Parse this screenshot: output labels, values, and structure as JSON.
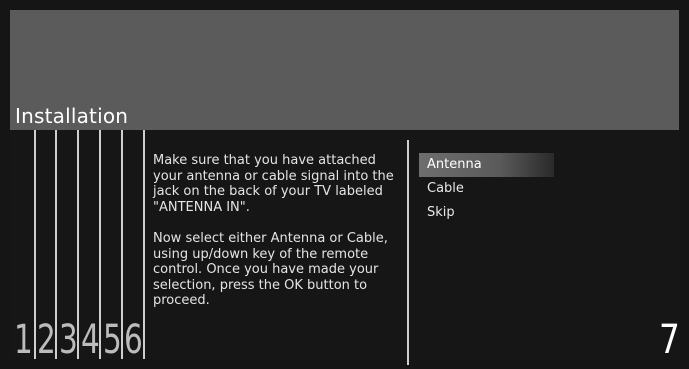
{
  "header": {
    "title": "Installation"
  },
  "steps": {
    "numbers": [
      "1",
      "2",
      "3",
      "4",
      "5",
      "6"
    ],
    "current": "7"
  },
  "instructions": {
    "paragraph1": "Make sure that you have attached your antenna or cable signal into the jack on the back of your TV labeled \"ANTENNA IN\".",
    "paragraph2": "Now select either Antenna or Cable, using up/down key of the remote control. Once you have made your selection, press the OK button to proceed."
  },
  "options": {
    "items": [
      {
        "label": "Antenna",
        "selected": true
      },
      {
        "label": "Cable",
        "selected": false
      },
      {
        "label": "Skip",
        "selected": false
      }
    ]
  },
  "colors": {
    "top_band": "#5b5b5b",
    "panel": "#161616",
    "selection": "#6e6e6e"
  }
}
